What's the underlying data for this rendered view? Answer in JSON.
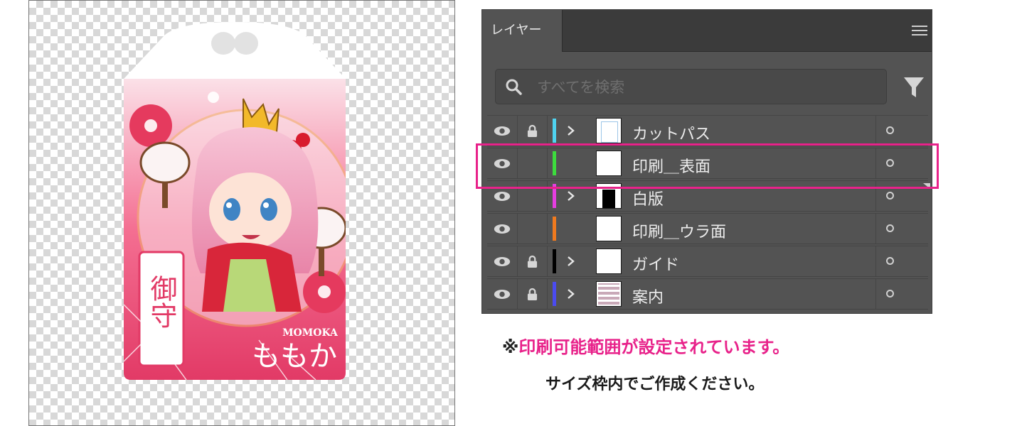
{
  "artwork": {
    "charm_title": "御守",
    "name_latin": "MOMOKA",
    "name_kana": "ももか"
  },
  "layers_panel": {
    "tab_label": "レイヤー",
    "menu_icon": "hamburger-menu-icon",
    "search_placeholder": "すべてを検索",
    "search_value": "",
    "layers": [
      {
        "name": "カットパス",
        "color": "#4fd3f0",
        "visible": true,
        "locked": true,
        "expandable": true
      },
      {
        "name": "印刷＿表面",
        "color": "#3ddc3d",
        "visible": true,
        "locked": false,
        "expandable": false,
        "highlighted": true
      },
      {
        "name": "白版",
        "color": "#e53ee0",
        "visible": true,
        "locked": false,
        "expandable": true
      },
      {
        "name": "印刷＿ウラ面",
        "color": "#f07a1e",
        "visible": true,
        "locked": false,
        "expandable": false
      },
      {
        "name": "ガイド",
        "color": "#000000",
        "visible": true,
        "locked": true,
        "expandable": true
      },
      {
        "name": "案内",
        "color": "#4b4bf0",
        "visible": true,
        "locked": true,
        "expandable": true
      }
    ],
    "accent_color": "#e8228a"
  },
  "notes": {
    "mark": "※",
    "line1": "印刷可能範囲が設定されています。",
    "line2": "サイズ枠内でご作成ください。"
  }
}
